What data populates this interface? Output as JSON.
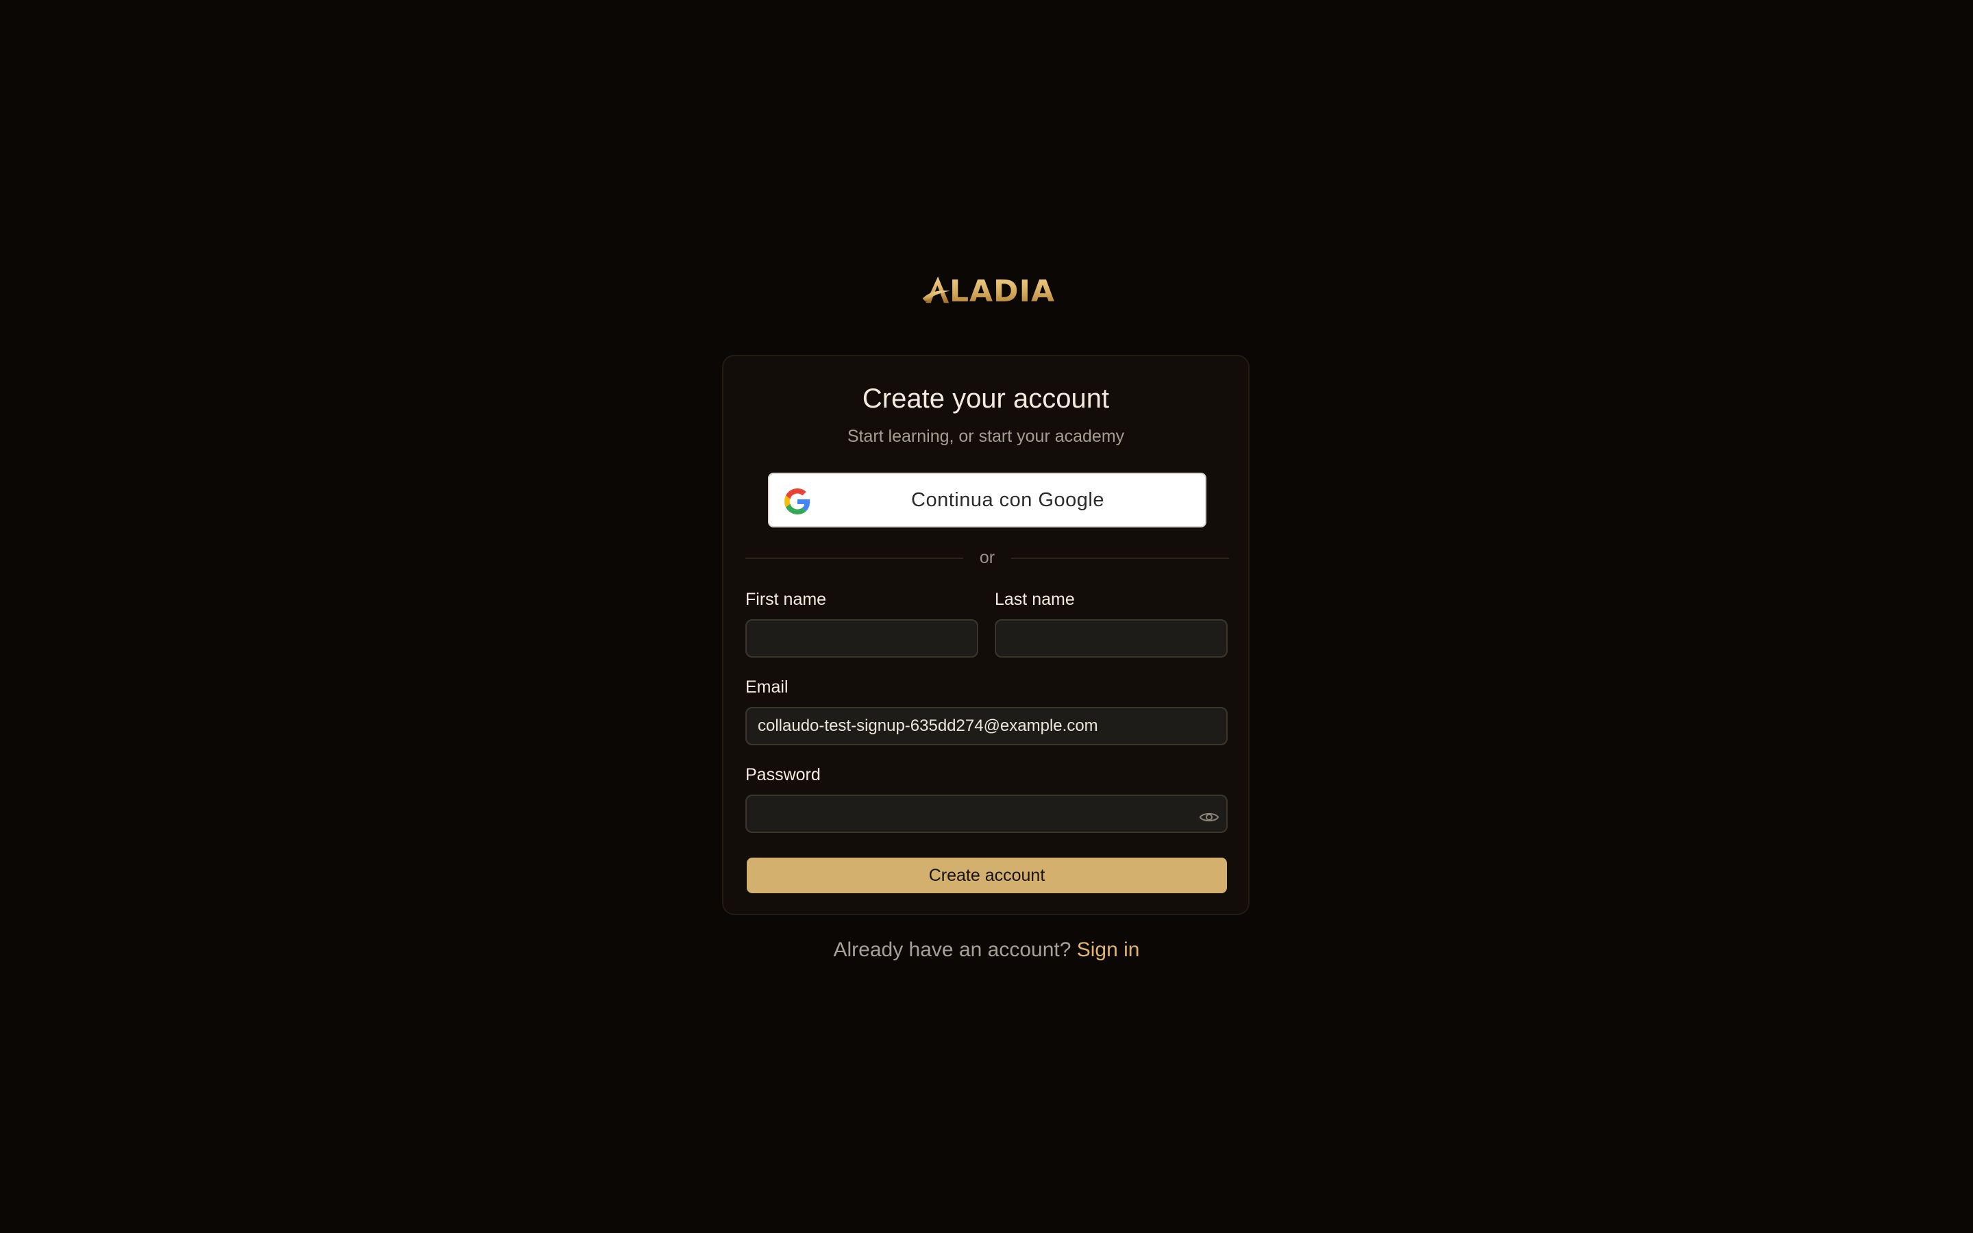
{
  "brand": {
    "logo_text": "LADIA",
    "logo_name": "ALADIA",
    "accent_color": "#d4b06e"
  },
  "card": {
    "title": "Create your account",
    "subtitle": "Start learning, or start your academy",
    "google_button_label": "Continua con Google",
    "divider_text": "or"
  },
  "form": {
    "first_name": {
      "label": "First name",
      "value": ""
    },
    "last_name": {
      "label": "Last name",
      "value": ""
    },
    "email": {
      "label": "Email",
      "value": "collaudo-test-signup-635dd274@example.com"
    },
    "password": {
      "label": "Password",
      "value": ""
    },
    "submit_label": "Create account"
  },
  "footer": {
    "prompt": "Already have an account?",
    "link_label": "Sign in"
  },
  "icons": {
    "google": "google-icon",
    "password_toggle": "eye-icon"
  }
}
